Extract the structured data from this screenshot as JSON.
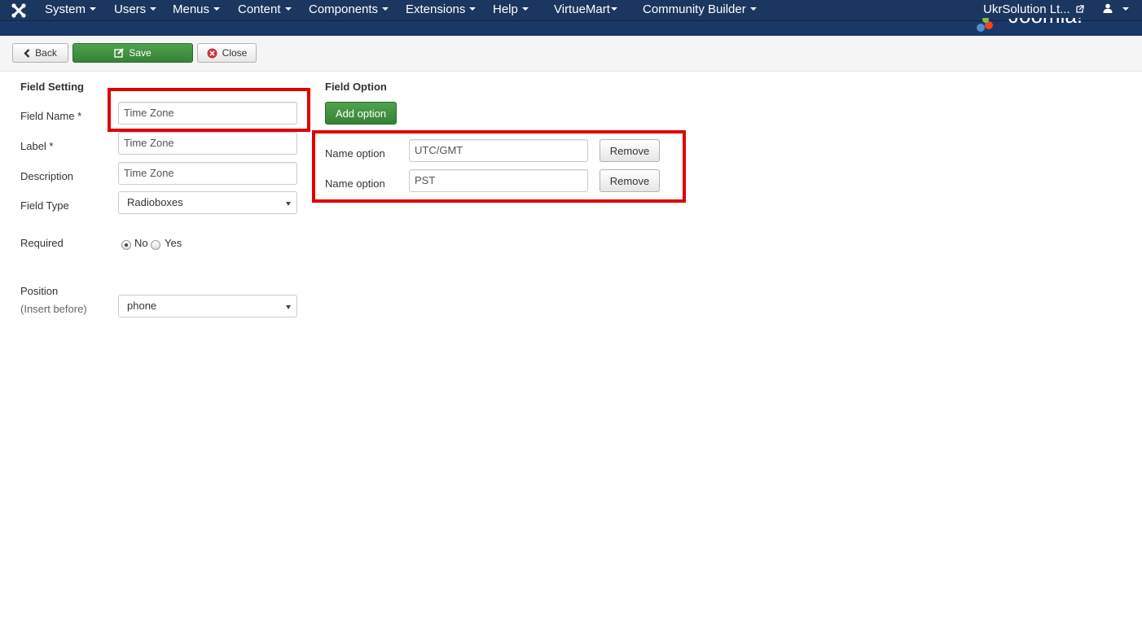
{
  "navbar": {
    "menus": [
      {
        "label": "System"
      },
      {
        "label": "Users"
      },
      {
        "label": "Menus"
      },
      {
        "label": "Content"
      },
      {
        "label": "Components"
      },
      {
        "label": "Extensions"
      },
      {
        "label": "Help"
      },
      {
        "label": "VirtueMart"
      },
      {
        "label": "Community Builder"
      }
    ],
    "site_link": "UkrSolution Lt...",
    "user_icon": "user-icon"
  },
  "toolbar": {
    "back_label": "Back",
    "save_label": "Save",
    "close_label": "Close"
  },
  "field_setting": {
    "title": "Field Setting",
    "field_name_label": "Field Name *",
    "field_name_value": "Time Zone",
    "label_label": "Label *",
    "label_value": "Time Zone",
    "description_label": "Description",
    "description_value": "Time Zone",
    "field_type_label": "Field Type",
    "field_type_value": "Radioboxes",
    "required_label": "Required",
    "required_no": "No",
    "required_yes": "Yes",
    "required_selected": "No",
    "position_label": "Position",
    "position_sub": "(Insert before)",
    "position_value": "phone"
  },
  "field_option": {
    "title": "Field Option",
    "add_label": "Add option",
    "options": [
      {
        "label": "Name option",
        "value": "UTC/GMT",
        "remove": "Remove"
      },
      {
        "label": "Name option",
        "value": "PST",
        "remove": "Remove"
      }
    ]
  },
  "colors": {
    "navbar": "#1b365f",
    "success": "#46a546",
    "highlight": "#e00000"
  }
}
